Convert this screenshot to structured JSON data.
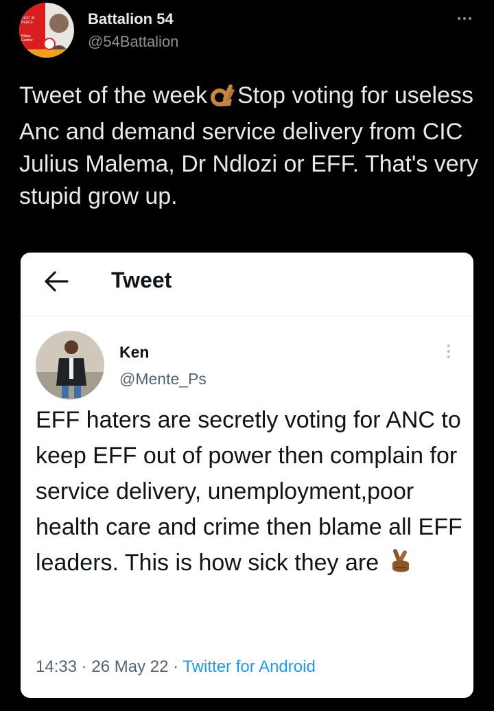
{
  "outer_tweet": {
    "display_name": "Battalion 54",
    "handle": "@54Battalion",
    "text_before_emoji": "Tweet of the week",
    "emoji": "ok-hand",
    "text_after_emoji": "Stop voting for useless Anc and demand service delivery from CIC Julius Malema, Dr Ndlozi or EFF. That's very stupid grow up.",
    "avatar_text": {
      "top": "REST IN PEACE",
      "middle": "Hillary Gardee"
    }
  },
  "quoted_screenshot": {
    "topbar": {
      "title": "Tweet"
    },
    "author": {
      "display_name": "Ken",
      "handle": "@Mente_Ps"
    },
    "text": "EFF haters are secretly voting for ANC to keep EFF out of power then complain for service delivery, unemployment,poor health care and crime then blame all EFF leaders. This is how sick they are",
    "emoji": "crossed-fingers",
    "meta": {
      "time": "14:33",
      "separator": " · ",
      "date": "26 May 22",
      "source": "Twitter for Android"
    }
  },
  "colors": {
    "background": "#000000",
    "card_background": "#ffffff",
    "link_blue": "#1d9bf0",
    "secondary_text": "#536471"
  }
}
